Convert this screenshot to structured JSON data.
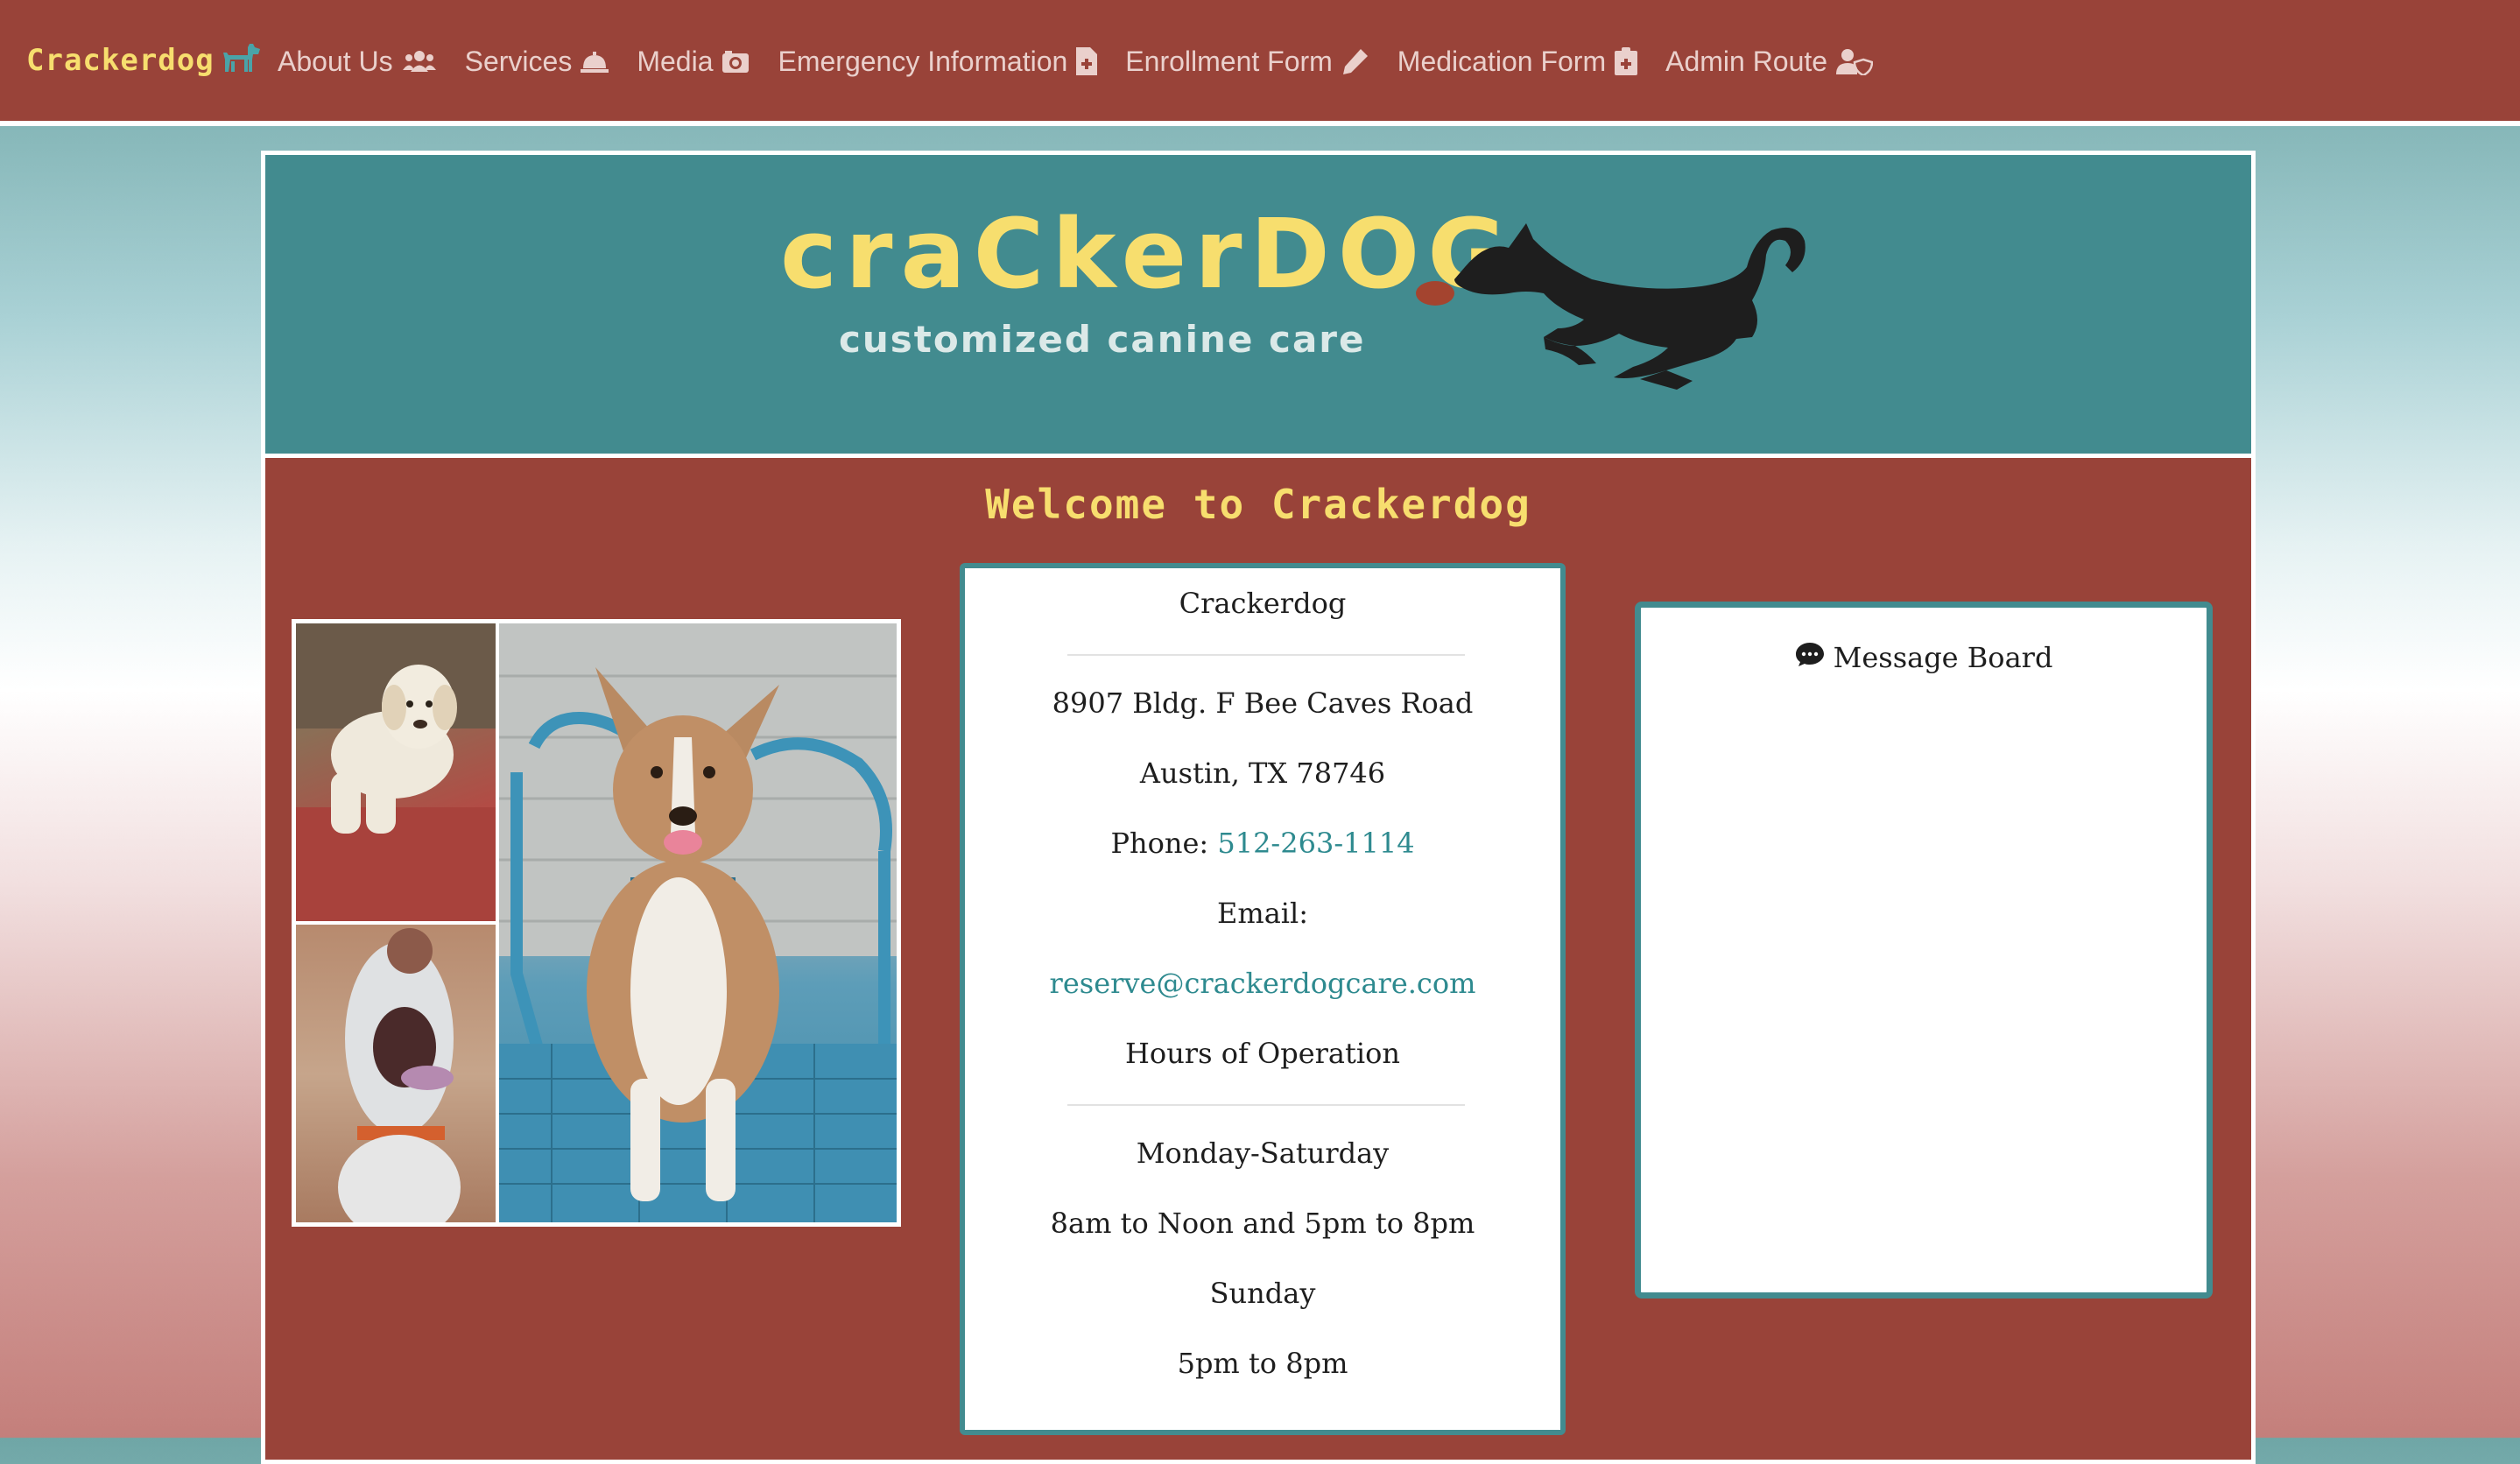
{
  "navbar": {
    "brand": "Crackerdog",
    "brand_icon": "dog-icon",
    "items": [
      {
        "label": "About Us",
        "icon": "users-icon"
      },
      {
        "label": "Services",
        "icon": "concierge-bell-icon"
      },
      {
        "label": "Media",
        "icon": "camera-icon"
      },
      {
        "label": "Emergency Information",
        "icon": "file-medical-icon"
      },
      {
        "label": "Enrollment Form",
        "icon": "pencil-icon"
      },
      {
        "label": "Medication Form",
        "icon": "clipboard-medical-icon"
      },
      {
        "label": "Admin Route",
        "icon": "user-shield-icon"
      }
    ]
  },
  "banner": {
    "logo_title": "craCkerDOG",
    "logo_subtitle": "customized canine care"
  },
  "welcome": "Welcome to Crackerdog",
  "info": {
    "name": "Crackerdog",
    "address_line1": "8907 Bldg. F Bee Caves Road",
    "address_line2": "Austin, TX 78746",
    "phone_label": "Phone:",
    "phone": "512-263-1114",
    "email_label": "Email:",
    "email": "reserve@crackerdogcare.com",
    "hours_title": "Hours of Operation",
    "weekday_label": "Monday-Saturday",
    "weekday_hours": "8am to Noon and 5pm to 8pm",
    "sunday_label": "Sunday",
    "sunday_hours": "5pm to 8pm"
  },
  "message_board": {
    "title": "Message Board",
    "icon": "comment-icon"
  },
  "colors": {
    "navbar_bg": "#994339",
    "brand_yellow": "#f7de6e",
    "teal": "#428b8f",
    "link_teal": "#2e8a8f",
    "nav_text": "#ead0cc"
  }
}
